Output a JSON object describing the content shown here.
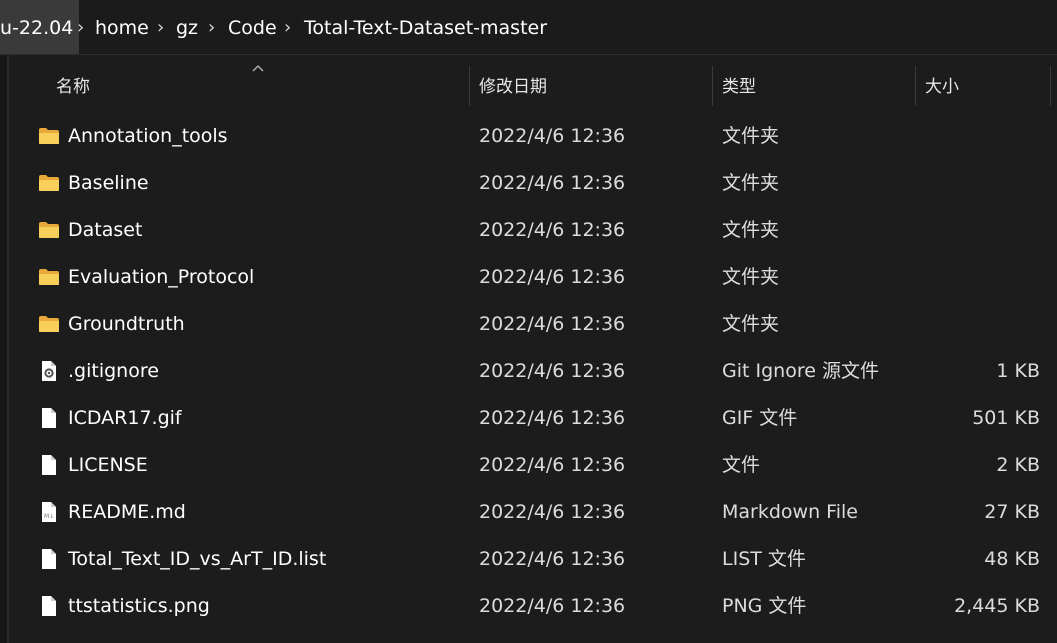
{
  "breadcrumb": [
    {
      "label": "u-22.04"
    },
    {
      "label": "home"
    },
    {
      "label": "gz"
    },
    {
      "label": "Code"
    },
    {
      "label": "Total-Text-Dataset-master"
    }
  ],
  "columns": {
    "name": "名称",
    "date": "修改日期",
    "type": "类型",
    "size": "大小"
  },
  "files": [
    {
      "name": "Annotation_tools",
      "date": "2022/4/6 12:36",
      "type": "文件夹",
      "size": "",
      "icon": "folder-icon"
    },
    {
      "name": "Baseline",
      "date": "2022/4/6 12:36",
      "type": "文件夹",
      "size": "",
      "icon": "folder-icon"
    },
    {
      "name": "Dataset",
      "date": "2022/4/6 12:36",
      "type": "文件夹",
      "size": "",
      "icon": "folder-icon"
    },
    {
      "name": "Evaluation_Protocol",
      "date": "2022/4/6 12:36",
      "type": "文件夹",
      "size": "",
      "icon": "folder-icon"
    },
    {
      "name": "Groundtruth",
      "date": "2022/4/6 12:36",
      "type": "文件夹",
      "size": "",
      "icon": "folder-icon"
    },
    {
      "name": ".gitignore",
      "date": "2022/4/6 12:36",
      "type": "Git Ignore 源文件",
      "size": "1 KB",
      "icon": "settings-file-icon"
    },
    {
      "name": "ICDAR17.gif",
      "date": "2022/4/6 12:36",
      "type": "GIF 文件",
      "size": "501 KB",
      "icon": "file-icon"
    },
    {
      "name": "LICENSE",
      "date": "2022/4/6 12:36",
      "type": "文件",
      "size": "2 KB",
      "icon": "file-icon"
    },
    {
      "name": "README.md",
      "date": "2022/4/6 12:36",
      "type": "Markdown File",
      "size": "27 KB",
      "icon": "markdown-file-icon"
    },
    {
      "name": "Total_Text_ID_vs_ArT_ID.list",
      "date": "2022/4/6 12:36",
      "type": "LIST 文件",
      "size": "48 KB",
      "icon": "file-icon"
    },
    {
      "name": "ttstatistics.png",
      "date": "2022/4/6 12:36",
      "type": "PNG 文件",
      "size": "2,445 KB",
      "icon": "file-icon"
    }
  ],
  "colors": {
    "background": "#1c1c1c",
    "folder": "#f5c242",
    "text": "#ffffff"
  }
}
